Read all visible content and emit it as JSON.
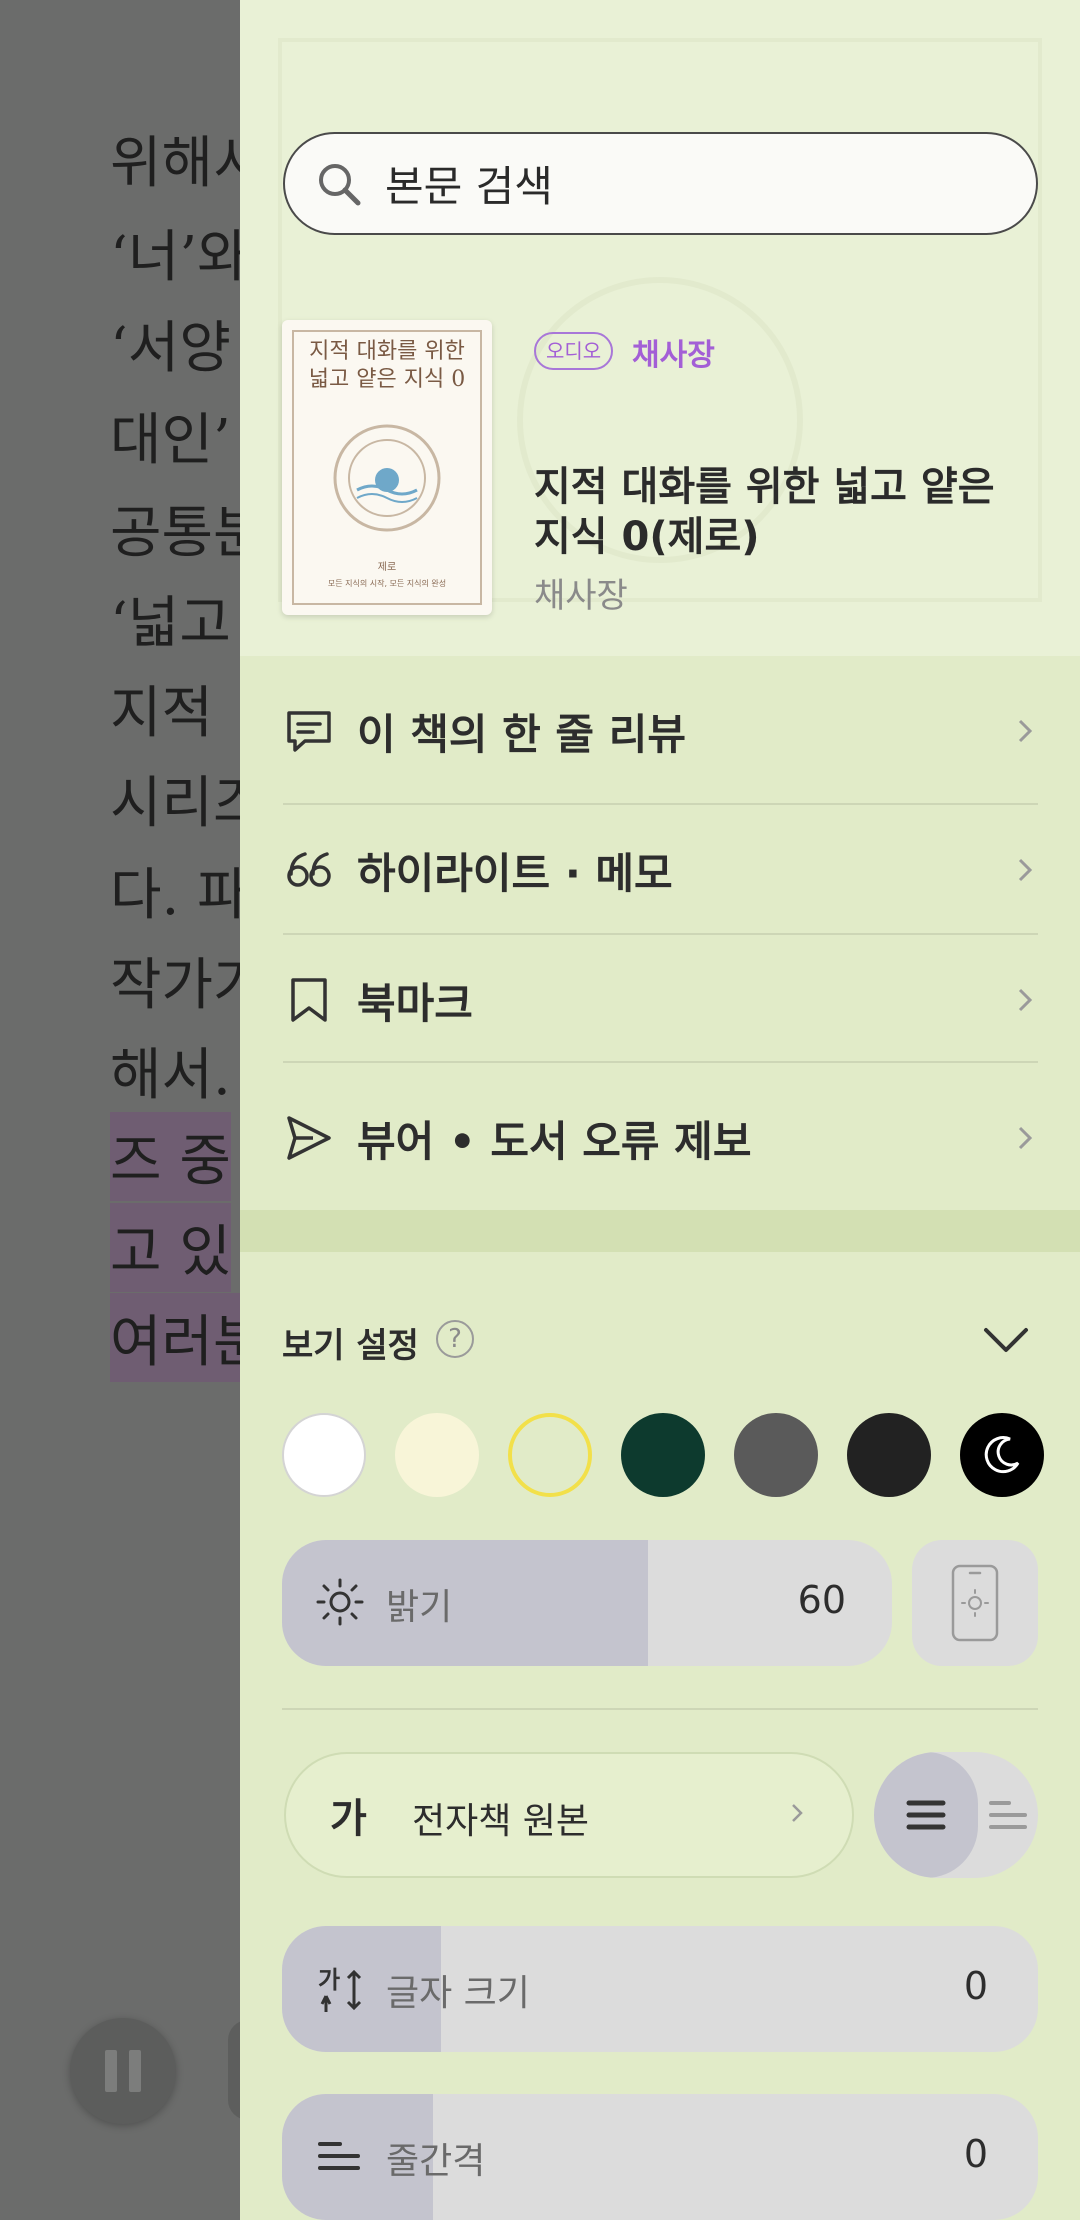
{
  "reader": {
    "lines": [
      "위해서",
      "‘너’와",
      "‘서양",
      "대인’",
      "공통분",
      "‘넓고",
      "지적",
      "시리즈",
      "다. 파",
      "작가가",
      "해서.",
      "즈 중",
      "고 있",
      "여러분"
    ]
  },
  "search": {
    "placeholder": "본문 검색"
  },
  "book": {
    "cover_title": "지적 대화를 위한 넓고 얕은 지식 0",
    "cover_publisher": "제로",
    "cover_subtitle": "모든 지식의 시작, 모든 지식의 완성",
    "audio_badge": "오디오",
    "narrator": "채사장",
    "title": "지적 대화를 위한 넓고 얕은 지식 0(제로)",
    "author": "채사장"
  },
  "menu": {
    "items": [
      {
        "label": "이 책의 한 줄 리뷰",
        "icon": "comment-icon"
      },
      {
        "label": "하이라이트 · 메모",
        "icon": "quote-icon"
      },
      {
        "label": "북마크",
        "icon": "bookmark-icon"
      },
      {
        "label": "뷰어 • 도서 오류 제보",
        "icon": "send-icon"
      }
    ]
  },
  "view_settings": {
    "title": "보기 설정",
    "help_symbol": "?",
    "themes": [
      {
        "name": "white",
        "color": "#ffffff"
      },
      {
        "name": "cream",
        "color": "#f8f5d8"
      },
      {
        "name": "light-green",
        "color": "#e1ebc8",
        "selected": true
      },
      {
        "name": "dark-green",
        "color": "#0d3a2e"
      },
      {
        "name": "gray",
        "color": "#5a5a5a"
      },
      {
        "name": "charcoal",
        "color": "#222222"
      },
      {
        "name": "night",
        "color": "#000000"
      }
    ],
    "brightness": {
      "label": "밝기",
      "value": "60",
      "level_percent": 60
    },
    "font": {
      "glyph": "가",
      "name": "전자책 원본"
    },
    "font_size": {
      "label": "글자 크기",
      "value": "0",
      "level_fraction": 0.21
    },
    "line_spacing": {
      "label": "줄간격",
      "value": "0",
      "level_fraction": 0.2
    }
  },
  "colors": {
    "accent_purple": "#a35fd6",
    "drawer_bg": "#e1ebc8",
    "selected_theme_ring": "#f2e04a"
  }
}
